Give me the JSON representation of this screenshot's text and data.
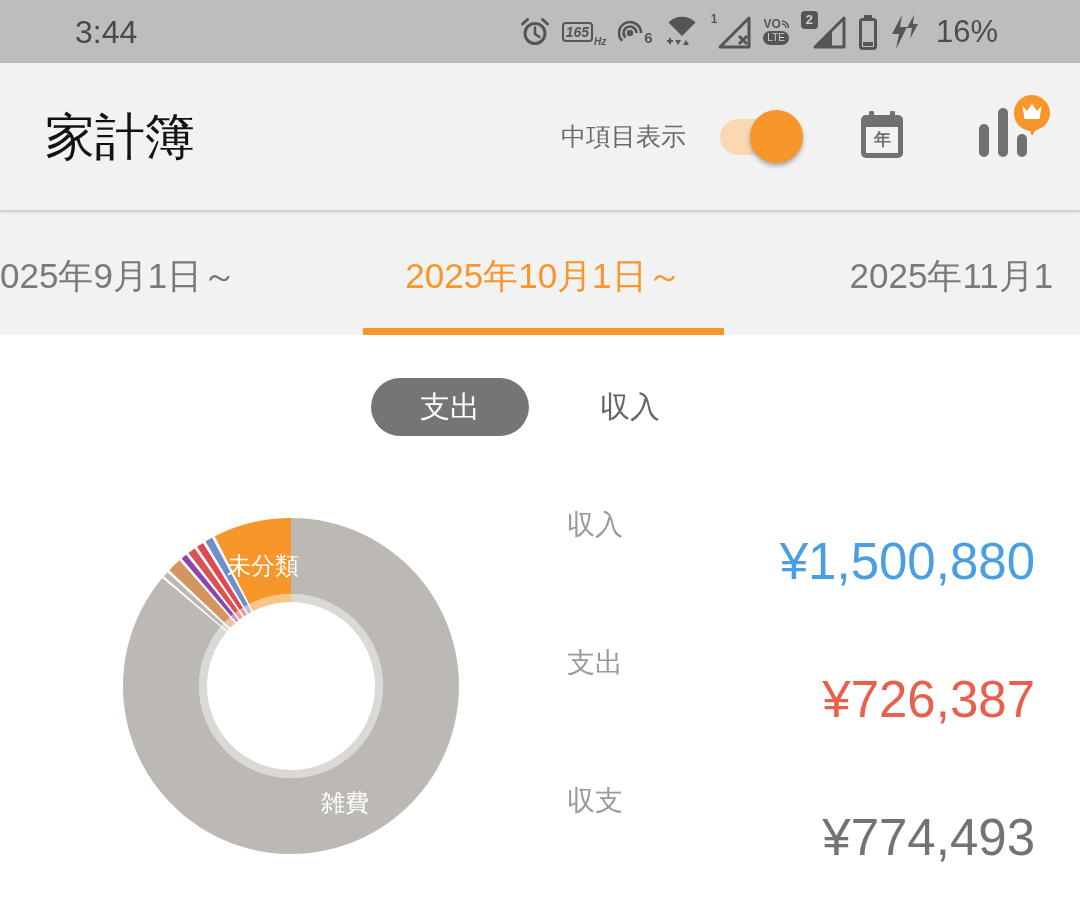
{
  "status_bar": {
    "time": "3:44",
    "refresh_rate": "165",
    "refresh_unit": "Hz",
    "hotspot_count": "6",
    "sim1_number": "1",
    "volte_label": "VO",
    "network_type": "LTE",
    "sim2_number": "2",
    "battery": "16%"
  },
  "app_bar": {
    "title": "家計簿",
    "toggle": {
      "label": "中項目表示",
      "on": true
    },
    "calendar_label": "年"
  },
  "period_tabs": [
    {
      "label": "025年9月1日～",
      "selected": false
    },
    {
      "label": "2025年10月1日～",
      "selected": true
    },
    {
      "label": "2025年11月1",
      "selected": false
    }
  ],
  "type_tabs": [
    {
      "label": "支出",
      "selected": true
    },
    {
      "label": "収入",
      "selected": false
    }
  ],
  "donut": {
    "slice_labels": [
      "未分類",
      "雑費"
    ]
  },
  "summary": [
    {
      "kind": "income",
      "label": "収入",
      "value": "¥1,500,880"
    },
    {
      "kind": "expense",
      "label": "支出",
      "value": "¥726,387"
    },
    {
      "kind": "balance",
      "label": "収支",
      "value": "¥774,493"
    }
  ]
}
